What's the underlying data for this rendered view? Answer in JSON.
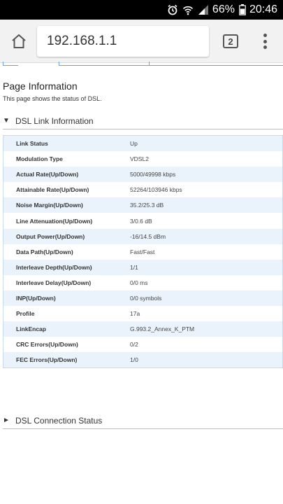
{
  "status_bar": {
    "battery_percent": "66%",
    "time": "20:46"
  },
  "browser": {
    "url": "192.168.1.1",
    "tab_count": "2"
  },
  "page": {
    "title": "Page Information",
    "description": "This page shows the status of DSL.",
    "sections": [
      {
        "label": "DSL Link Information",
        "expanded": true
      },
      {
        "label": "DSL Connection Status",
        "expanded": false
      }
    ],
    "link_info": [
      {
        "key": "Link Status",
        "value": "Up"
      },
      {
        "key": "Modulation Type",
        "value": "VDSL2"
      },
      {
        "key": "Actual Rate(Up/Down)",
        "value": "5000/49998 kbps"
      },
      {
        "key": "Attainable Rate(Up/Down)",
        "value": "52264/103946 kbps"
      },
      {
        "key": "Noise Margin(Up/Down)",
        "value": "35.2/25.3 dB"
      },
      {
        "key": "Line Attenuation(Up/Down)",
        "value": "3/0.6 dB"
      },
      {
        "key": "Output Power(Up/Down)",
        "value": "-16/14.5 dBm"
      },
      {
        "key": "Data Path(Up/Down)",
        "value": "Fast/Fast"
      },
      {
        "key": "Interleave Depth(Up/Down)",
        "value": "1/1"
      },
      {
        "key": "Interleave Delay(Up/Down)",
        "value": "0/0 ms"
      },
      {
        "key": "INP(Up/Down)",
        "value": "0/0 symbols"
      },
      {
        "key": "Profile",
        "value": "17a"
      },
      {
        "key": "LinkEncap",
        "value": "G.993.2_Annex_K_PTM"
      },
      {
        "key": "CRC Errors(Up/Down)",
        "value": "0/2"
      },
      {
        "key": "FEC Errors(Up/Down)",
        "value": "1/0"
      }
    ]
  },
  "colors": {
    "row_alt_bg": "#eaf3fc",
    "table_border": "#c9d9e8",
    "tab_line": "#6aa3d5"
  }
}
